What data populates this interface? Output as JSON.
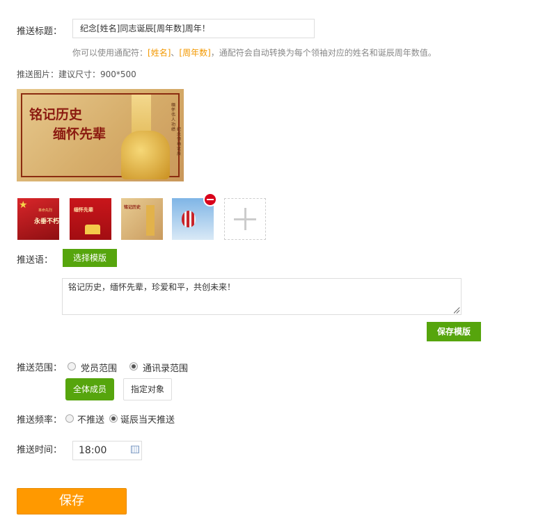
{
  "title_row": {
    "label": "推送标题：",
    "value": "纪念[姓名]同志诞辰[周年数]周年！",
    "hint_prefix": "你可以使用通配符：",
    "hint_var1": "[姓名]",
    "hint_sep": "、",
    "hint_var2": "[周年数]",
    "hint_suffix": "，通配符会自动转换为每个领袖对应的姓名和诞辰周年数值。"
  },
  "image_row": {
    "label": "推送图片：建议尺寸：900*500",
    "main_image": {
      "line1": "铭记历史",
      "line2": "缅怀先辈",
      "vertical1": "缅怀伟人功绩",
      "vertical2": "纪念领袖诞辰"
    },
    "thumbnails": [
      {
        "text": "永垂不朽",
        "top": "革命先烈"
      },
      {
        "text": "缅怀先辈"
      },
      {
        "text": "铭记历史"
      },
      {
        "text": ""
      }
    ]
  },
  "message_row": {
    "label": "推送语：",
    "choose_template_label": "选择模版",
    "content": "铭记历史，缅怀先辈，珍爱和平，共创未来！",
    "save_template_label": "保存模版"
  },
  "scope_row": {
    "label": "推送范围：",
    "option1": "党员范围",
    "option2": "通讯录范围",
    "selected": "通讯录范围",
    "all_members_label": "全体成员",
    "specify_label": "指定对象"
  },
  "frequency_row": {
    "label": "推送频率：",
    "option1": "不推送",
    "option2": "诞辰当天推送",
    "selected": "诞辰当天推送"
  },
  "time_row": {
    "label": "推送时间：",
    "value": "18:00"
  },
  "save_label": "保存",
  "colors": {
    "green": "#56a50d",
    "orange": "#ff9900",
    "highlight": "#f39800",
    "remove_red": "#d9001b"
  }
}
